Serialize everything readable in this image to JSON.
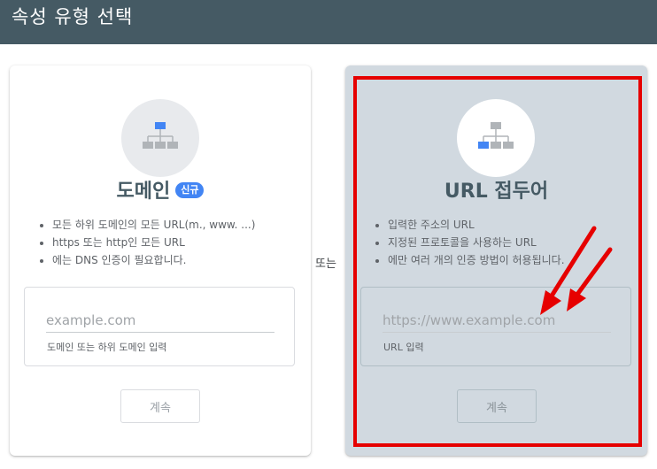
{
  "header": {
    "title": "속성 유형 선택"
  },
  "domain_card": {
    "title": "도메인",
    "badge": "신규",
    "bullets": [
      "모든 하위 도메인의 모든 URL(m., www. ...)",
      "https 또는 http인 모든 URL",
      "에는 DNS 인증이 필요합니다."
    ],
    "input_placeholder": "example.com",
    "input_help": "도메인 또는 하위 도메인 입력",
    "continue_label": "계속",
    "icon": "domain-hierarchy-icon"
  },
  "or_label": "또는",
  "url_card": {
    "title": "URL 접두어",
    "bullets": [
      "입력한 주소의 URL",
      "지정된 프로토콜을 사용하는 URL",
      "에만 여러 개의 인증 방법이 허용됩니다."
    ],
    "input_placeholder": "https://www.example.com",
    "input_help": "URL 입력",
    "continue_label": "계속",
    "icon": "url-prefix-hierarchy-icon"
  },
  "colors": {
    "header_bg": "#455a64",
    "accent": "#4285f4",
    "highlight": "#e60000",
    "url_card_bg": "#d1d9e0"
  }
}
